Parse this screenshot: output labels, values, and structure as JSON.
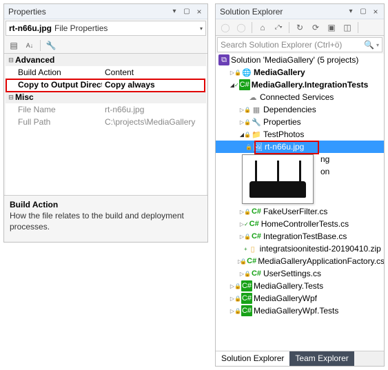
{
  "properties": {
    "title": "Properties",
    "combo_file": "rt-n66u.jpg",
    "combo_type": "File Properties",
    "groups": {
      "advanced": {
        "label": "Advanced",
        "rows": [
          {
            "label": "Build Action",
            "value": "Content"
          },
          {
            "label": "Copy to Output Directory",
            "value": "Copy always"
          }
        ]
      },
      "misc": {
        "label": "Misc",
        "rows": [
          {
            "label": "File Name",
            "value": "rt-n66u.jpg"
          },
          {
            "label": "Full Path",
            "value": "C:\\projects\\MediaGallery"
          }
        ]
      }
    },
    "desc_title": "Build Action",
    "desc_body": "How the file relates to the build and deployment processes."
  },
  "solution": {
    "title": "Solution Explorer",
    "search_placeholder": "Search Solution Explorer (Ctrl+ö)",
    "root": "Solution 'MediaGallery' (5 projects)",
    "tree": {
      "p1": "MediaGallery",
      "p2": "MediaGallery.IntegrationTests",
      "p2items": {
        "connected": "Connected Services",
        "deps": "Dependencies",
        "props": "Properties",
        "photos": "TestPhotos",
        "selected": "rt-n66u.jpg",
        "hidden1": "ng",
        "hidden2": "on",
        "f1": "FakeUserFilter.cs",
        "f2": "HomeControllerTests.cs",
        "f3": "IntegrationTestBase.cs",
        "f4": "integratsioonitestid-20190410.zip",
        "f5": "MediaGalleryApplicationFactory.cs",
        "f6": "UserSettings.cs"
      },
      "p3": "MediaGallery.Tests",
      "p4": "MediaGalleryWpf",
      "p5": "MediaGalleryWpf.Tests"
    },
    "tabs": {
      "active": "Solution Explorer",
      "other": "Team Explorer"
    }
  }
}
